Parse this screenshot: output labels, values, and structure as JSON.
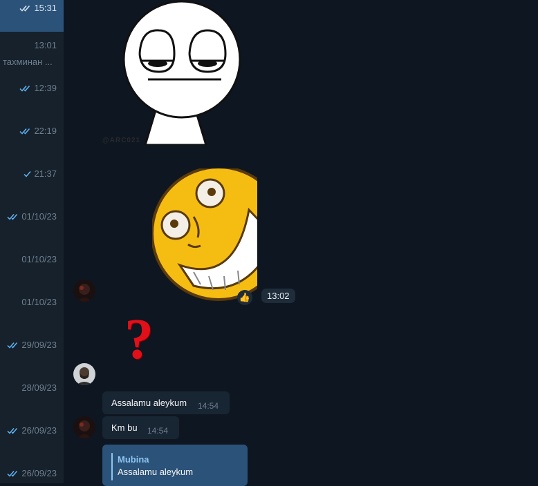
{
  "sidebar": {
    "rows": [
      {
        "time": "15:31",
        "status": "read",
        "preview": ""
      },
      {
        "time": "13:01",
        "status": "",
        "preview": "тахминан ..."
      },
      {
        "time": "12:39",
        "status": "read",
        "preview": ""
      },
      {
        "time": "22:19",
        "status": "read",
        "preview": ""
      },
      {
        "time": "21:37",
        "status": "sent",
        "preview": ""
      },
      {
        "time": "01/10/23",
        "status": "read",
        "preview": ""
      },
      {
        "time": "01/10/23",
        "status": "",
        "preview": ""
      },
      {
        "time": "01/10/23",
        "status": "",
        "preview": ""
      },
      {
        "time": "29/09/23",
        "status": "read",
        "preview": ""
      },
      {
        "time": "28/09/23",
        "status": "",
        "preview": ""
      },
      {
        "time": "26/09/23",
        "status": "read",
        "preview": ""
      },
      {
        "time": "26/09/23",
        "status": "read",
        "preview": ""
      }
    ]
  },
  "chat": {
    "sticker_watermark": "@ARC021",
    "laugh_sticker_time": "13:02",
    "reaction_icon": "thumbs-up-icon",
    "reaction_emoji": "👍",
    "question_mark": "?",
    "messages": [
      {
        "text": "Assalamu aleykum",
        "time": "14:54"
      },
      {
        "text": "Km bu",
        "time": "14:54"
      }
    ],
    "reply": {
      "name": "Mubina",
      "text": "Assalamu aleykum"
    }
  },
  "colors": {
    "chat_bg": "#0e1621",
    "sidebar_bg": "#17212b",
    "active_row": "#2b5278",
    "bubble_in": "#182533",
    "bubble_out": "#2b5278",
    "read_tick": "#5eb5f7",
    "question_red": "#e0101a"
  }
}
